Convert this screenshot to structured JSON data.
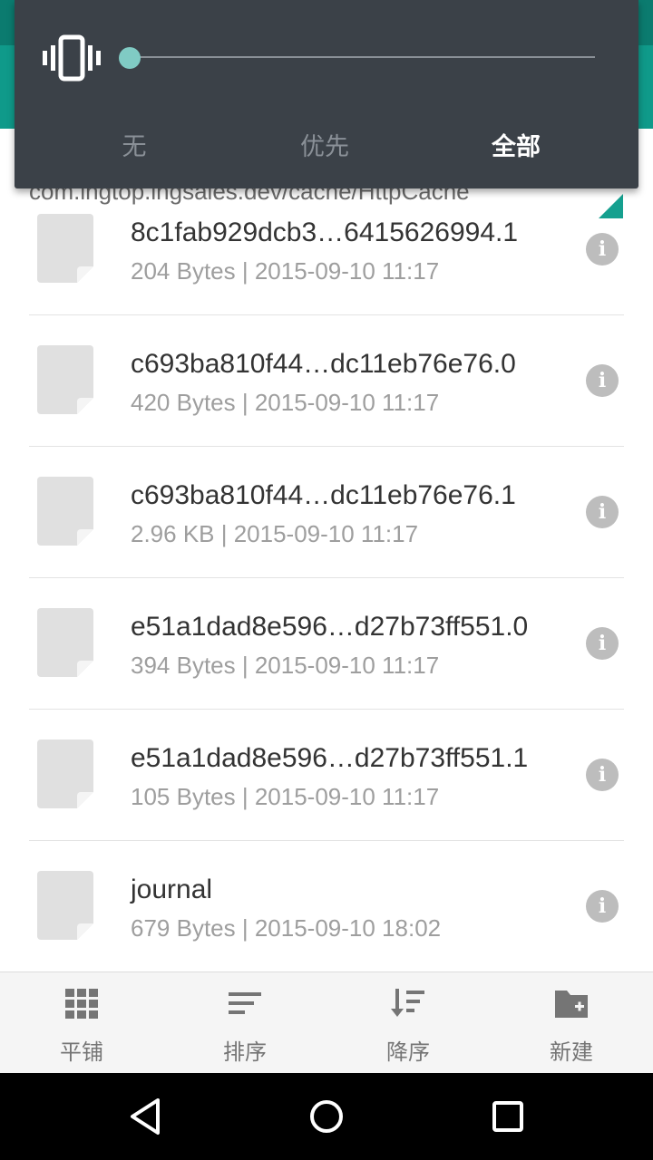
{
  "volume_panel": {
    "level": 0.0,
    "modes": [
      "无",
      "优先",
      "全部"
    ],
    "selected_mode": "全部",
    "accent_color": "#80cbc4",
    "icon": "vibrate-icon"
  },
  "path": {
    "text": "com.lngtop.lngsales.dev/cache/HttpCache"
  },
  "files": [
    {
      "name": "8c1fab929dcb3…6415626994.1",
      "meta": "204 Bytes | 2015-09-10 11:17"
    },
    {
      "name": "c693ba810f44…dc11eb76e76.0",
      "meta": "420 Bytes | 2015-09-10 11:17"
    },
    {
      "name": "c693ba810f44…dc11eb76e76.1",
      "meta": "2.96 KB | 2015-09-10 11:17"
    },
    {
      "name": "e51a1dad8e596…d27b73ff551.0",
      "meta": "394 Bytes | 2015-09-10 11:17"
    },
    {
      "name": "e51a1dad8e596…d27b73ff551.1",
      "meta": "105 Bytes | 2015-09-10 11:17"
    },
    {
      "name": "journal",
      "meta": "679 Bytes | 2015-09-10 18:02"
    }
  ],
  "info_icon_glyph": "i",
  "toolbar": {
    "tile_label": "平铺",
    "sort_label": "排序",
    "desc_label": "降序",
    "new_label": "新建"
  },
  "colors": {
    "primary": "#0f9a8a",
    "panel": "#3b4148"
  }
}
